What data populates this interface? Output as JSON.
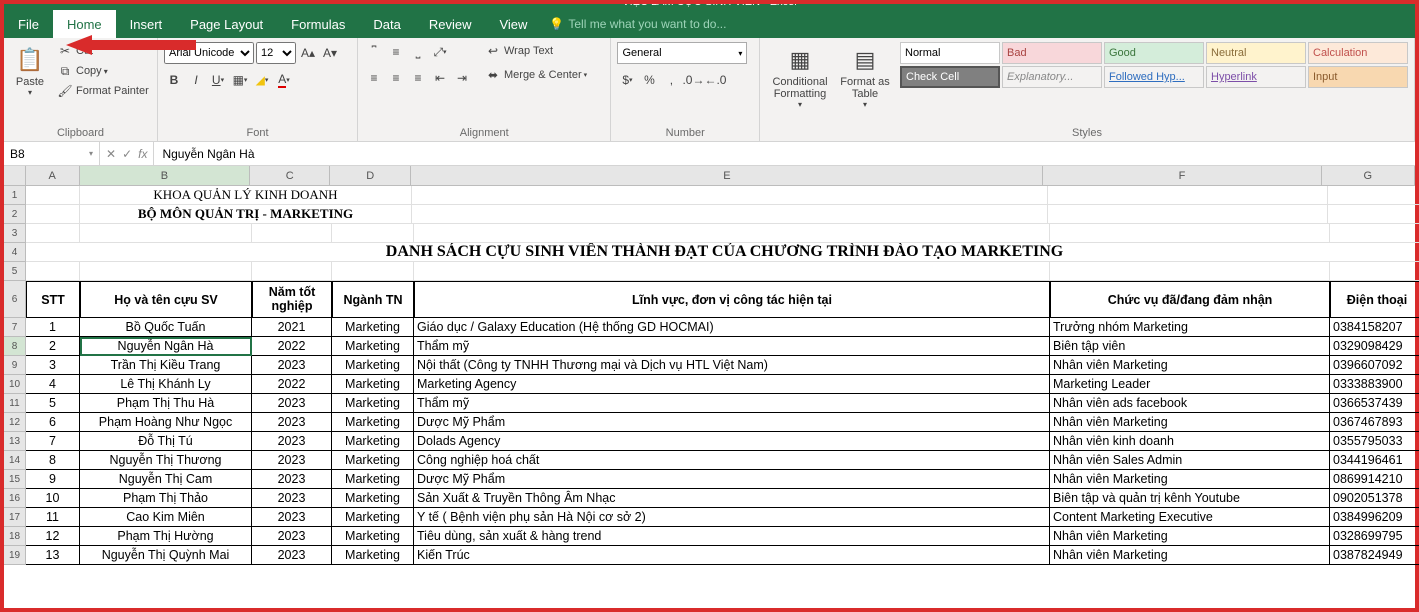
{
  "title_bar": "VIỆC LÀM CỰU SINH VIÊN - Excel",
  "tabs": {
    "file": "File",
    "home": "Home",
    "insert": "Insert",
    "page_layout": "Page Layout",
    "formulas": "Formulas",
    "data": "Data",
    "review": "Review",
    "view": "View"
  },
  "tellme": "Tell me what you want to do...",
  "ribbon": {
    "clipboard": {
      "paste": "Paste",
      "cut": "Cut",
      "copy": "Copy",
      "format_painter": "Format Painter",
      "label": "Clipboard"
    },
    "font": {
      "name": "Arial Unicode MS",
      "size": "12",
      "label": "Font"
    },
    "alignment": {
      "wrap": "Wrap Text",
      "merge": "Merge & Center",
      "label": "Alignment"
    },
    "number": {
      "format": "General",
      "label": "Number"
    },
    "cond": "Conditional Formatting",
    "fmt_table": "Format as Table",
    "styles": {
      "normal": "Normal",
      "bad": "Bad",
      "good": "Good",
      "neutral": "Neutral",
      "calc": "Calculation",
      "check": "Check Cell",
      "explan": "Explanatory...",
      "fhyp": "Followed Hyp...",
      "hyp": "Hyperlink",
      "input": "Input",
      "label": "Styles"
    }
  },
  "namebox": "B8",
  "formula": "Nguyễn Ngân Hà",
  "col_headers": [
    "A",
    "B",
    "C",
    "D",
    "E",
    "F",
    "G"
  ],
  "row_headers": [
    "1",
    "2",
    "3",
    "4",
    "5",
    "6",
    "7",
    "8",
    "9",
    "10",
    "11",
    "12",
    "13",
    "14",
    "15",
    "16",
    "17",
    "18",
    "19"
  ],
  "sheet": {
    "r1": "KHOA QUẢN LÝ KINH DOANH",
    "r2": "BỘ MÔN QUẢN TRỊ - MARKETING",
    "r4": "DANH SÁCH CỰU SINH VIÊN THÀNH ĐẠT CỦA CHƯƠNG TRÌNH ĐÀO TẠO MARKETING"
  },
  "table_head": {
    "a": "STT",
    "b": "Họ và tên cựu SV",
    "c": "Năm tốt nghiệp",
    "d": "Ngành TN",
    "e": "Lĩnh vực, đơn vị công tác hiện tại",
    "f": "Chức vụ đã/đang đảm nhận",
    "g": "Điện thoại"
  },
  "rows": [
    {
      "a": "1",
      "b": "Bồ Quốc Tuấn",
      "c": "2021",
      "d": "Marketing",
      "e": "Giáo dục / Galaxy Education (Hệ thống GD HOCMAI)",
      "f": "Trưởng nhóm Marketing",
      "g": "0384158207"
    },
    {
      "a": "2",
      "b": "Nguyễn Ngân Hà",
      "c": "2022",
      "d": "Marketing",
      "e": "Thẩm mỹ",
      "f": "Biên tập viên",
      "g": "0329098429"
    },
    {
      "a": "3",
      "b": "Trần Thị Kiều Trang",
      "c": "2023",
      "d": "Marketing",
      "e": "Nội thất (Công ty TNHH Thương mại và Dịch vụ HTL Việt Nam)",
      "f": "Nhân viên Marketing",
      "g": "0396607092"
    },
    {
      "a": "4",
      "b": "Lê Thị Khánh Ly",
      "c": "2022",
      "d": "Marketing",
      "e": "Marketing Agency",
      "f": "Marketing Leader",
      "g": "0333883900"
    },
    {
      "a": "5",
      "b": "Phạm Thị Thu Hà",
      "c": "2023",
      "d": "Marketing",
      "e": "Thẩm mỹ",
      "f": "Nhân viên ads facebook",
      "g": "0366537439"
    },
    {
      "a": "6",
      "b": "Phạm Hoàng Như Ngọc",
      "c": "2023",
      "d": "Marketing",
      "e": "Dược Mỹ Phẩm",
      "f": "Nhân viên Marketing",
      "g": "0367467893"
    },
    {
      "a": "7",
      "b": "Đỗ Thị Tú",
      "c": "2023",
      "d": "Marketing",
      "e": "Dolads Agency",
      "f": "Nhân viên kinh doanh",
      "g": "0355795033"
    },
    {
      "a": "8",
      "b": "Nguyễn Thị Thương",
      "c": "2023",
      "d": "Marketing",
      "e": "Công nghiệp hoá chất",
      "f": "Nhân viên Sales Admin",
      "g": "0344196461"
    },
    {
      "a": "9",
      "b": "Nguyễn Thị Cam",
      "c": "2023",
      "d": "Marketing",
      "e": "Dược Mỹ Phẩm",
      "f": "Nhân viên Marketing",
      "g": "0869914210"
    },
    {
      "a": "10",
      "b": "Phạm Thị Thảo",
      "c": "2023",
      "d": "Marketing",
      "e": "Sản Xuất & Truyền Thông Âm Nhạc",
      "f": "Biên tập và quản trị kênh Youtube",
      "g": "0902051378"
    },
    {
      "a": "11",
      "b": "Cao Kim Miên",
      "c": "2023",
      "d": "Marketing",
      "e": "Y tế ( Bệnh viện phụ sản Hà Nội cơ sở 2)",
      "f": "Content Marketing Executive",
      "g": "0384996209"
    },
    {
      "a": "12",
      "b": "Phạm Thị Hường",
      "c": "2023",
      "d": "Marketing",
      "e": "Tiêu dùng, sản xuất & hàng trend",
      "f": "Nhân viên Marketing",
      "g": "0328699795"
    },
    {
      "a": "13",
      "b": "Nguyễn Thị Quỳnh Mai",
      "c": "2023",
      "d": "Marketing",
      "e": "Kiến Trúc",
      "f": "Nhân viên Marketing",
      "g": "0387824949"
    }
  ]
}
